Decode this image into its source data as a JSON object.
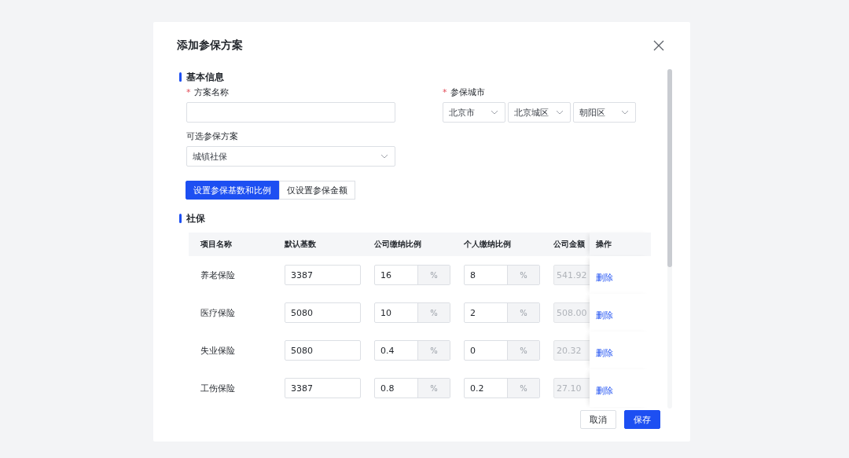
{
  "dialog": {
    "title": "添加参保方案"
  },
  "basic_section": {
    "title": "基本信息",
    "plan_name": {
      "label": "方案名称",
      "required_mark": "*"
    },
    "city": {
      "label": "参保城市",
      "required_mark": "*",
      "selects": [
        {
          "value": "北京市"
        },
        {
          "value": "北京城区"
        },
        {
          "value": "朝阳区"
        }
      ]
    },
    "optional_plan": {
      "label": "可选参保方案",
      "value": "城镇社保"
    },
    "modes": [
      {
        "label": "设置参保基数和比例",
        "selected": true
      },
      {
        "label": "仅设置参保金额",
        "selected": false
      }
    ]
  },
  "social_section": {
    "title": "社保",
    "table": {
      "columns": [
        "项目名称",
        "默认基数",
        "公司缴纳比例",
        "个人缴纳比例",
        "公司金额",
        "操作"
      ],
      "rows": [
        {
          "name": "养老保险",
          "base": "3387",
          "company_rate": {
            "value": "16",
            "unit": "%"
          },
          "personal_rate": {
            "value": "8",
            "unit": "%"
          },
          "company_amount": "541.92",
          "action": "删除"
        },
        {
          "name": "医疗保险",
          "base": "5080",
          "company_rate": {
            "value": "10",
            "unit": "%"
          },
          "personal_rate": {
            "value": "2",
            "unit": "%"
          },
          "company_amount": "508.00",
          "action": "删除"
        },
        {
          "name": "失业保险",
          "base": "5080",
          "company_rate": {
            "value": "0.4",
            "unit": "%"
          },
          "personal_rate": {
            "value": "0",
            "unit": "%"
          },
          "company_amount": "20.32",
          "action": "删除"
        },
        {
          "name": "工伤保险",
          "base": "3387",
          "company_rate": {
            "value": "0.8",
            "unit": "%"
          },
          "personal_rate": {
            "value": "0.2",
            "unit": "%"
          },
          "company_amount": "27.10",
          "action": "删除"
        }
      ]
    }
  },
  "footer": {
    "buttons": [
      {
        "label": "取消",
        "kind": "secondary"
      },
      {
        "label": "保存",
        "kind": "primary"
      }
    ]
  }
}
